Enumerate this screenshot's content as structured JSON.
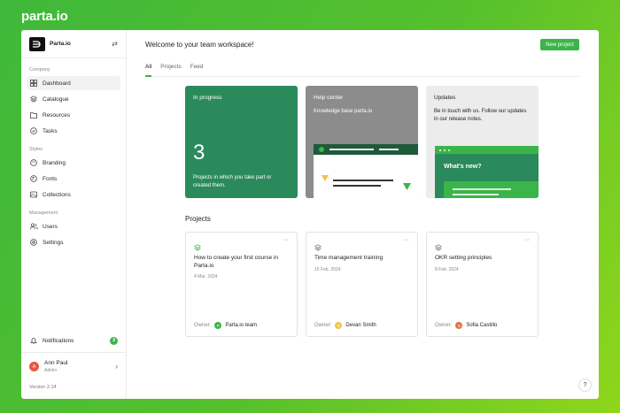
{
  "brand": "parta.io",
  "workspace": {
    "name": "Parta.io",
    "logo_icon": "parta-logo-icon"
  },
  "sidebar": {
    "sections": [
      {
        "label": "Company",
        "items": [
          {
            "label": "Dashboard",
            "icon": "grid-icon",
            "active": true
          },
          {
            "label": "Catalogue",
            "icon": "layers-icon"
          },
          {
            "label": "Resources",
            "icon": "folder-icon"
          },
          {
            "label": "Tasks",
            "icon": "check-circle-icon"
          }
        ]
      },
      {
        "label": "Styles",
        "items": [
          {
            "label": "Branding",
            "icon": "palette-icon"
          },
          {
            "label": "Fonts",
            "icon": "font-icon"
          },
          {
            "label": "Collections",
            "icon": "image-icon"
          }
        ]
      },
      {
        "label": "Management",
        "items": [
          {
            "label": "Users",
            "icon": "users-icon"
          },
          {
            "label": "Settings",
            "icon": "settings-icon"
          }
        ]
      }
    ],
    "notifications": {
      "label": "Notifications",
      "count": "3"
    },
    "user": {
      "initial": "A",
      "name": "Ann Paul",
      "role": "Admin"
    },
    "version": "Version 2.14"
  },
  "header": {
    "title": "Welcome to your team workspace!",
    "new_project": "New project"
  },
  "tabs": [
    {
      "label": "All",
      "active": true
    },
    {
      "label": "Projects"
    },
    {
      "label": "Feed"
    }
  ],
  "cards": {
    "progress": {
      "title": "In progress",
      "count": "3",
      "text": "Projects in which you take part or created them."
    },
    "help": {
      "title": "Help center",
      "text": "Knowledge base parta.io"
    },
    "updates": {
      "title": "Updates",
      "text": "Be in touch with us. Follow our updates in our release notes.",
      "whats_new": "What's new?"
    }
  },
  "projects": {
    "heading": "Projects",
    "owner_label": "Owner:",
    "items": [
      {
        "title": "How to create your first course in Parta.io",
        "date": "4 Mar. 2024",
        "owner": "Parta.io team",
        "owner_initial": "P",
        "owner_color": "#3ab54a"
      },
      {
        "title": "Time management training",
        "date": "15 Feb. 2024",
        "owner": "Devan Smith",
        "owner_initial": "D",
        "owner_color": "#f2c14e"
      },
      {
        "title": "OKR setting principles",
        "date": "8 Feb. 2024",
        "owner": "Sofia Castillo",
        "owner_initial": "S",
        "owner_color": "#e8733f"
      }
    ]
  },
  "colors": {
    "accent": "#3ab54a",
    "progress_card": "#2b8a5c",
    "help_card": "#8c8c8c"
  }
}
